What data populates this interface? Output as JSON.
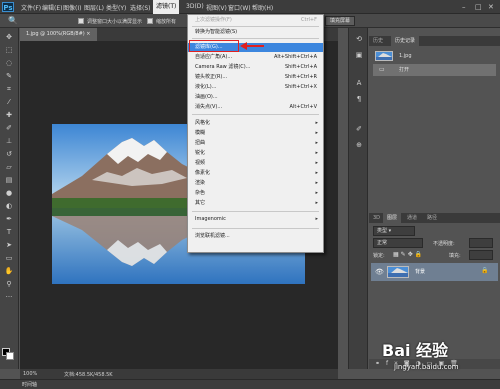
{
  "app": {
    "logo": "Ps"
  },
  "menubar": {
    "items": [
      "文件(F)",
      "编辑(E)",
      "图像(I)",
      "图层(L)",
      "类型(Y)",
      "选择(S)",
      "滤镜(T)",
      "3D(D)",
      "视图(V)",
      "窗口(W)",
      "帮助(H)"
    ],
    "active": "滤镜(T)"
  },
  "optbar": {
    "opt1": "调整窗口大小以满屏显示",
    "opt2": "缩放所有",
    "btn_fill": "填充屏幕"
  },
  "document": {
    "tab_label": "1.jpg @ 100%(RGB/8#)"
  },
  "status": {
    "zoom": "100%",
    "doc_info": "文档:458.5K/458.5K",
    "timeline": "时间轴"
  },
  "filter_menu": {
    "items": [
      {
        "label": "上次滤镜操作(F)",
        "shortcut": "Ctrl+F",
        "state": "disabled"
      },
      {
        "label": "转换为智能滤镜(S)",
        "shortcut": "",
        "state": "normal"
      },
      {
        "label": "滤镜库(G)...",
        "shortcut": "",
        "state": "highlighted"
      },
      {
        "label": "自适应广角(A)...",
        "shortcut": "Alt+Shift+Ctrl+A",
        "state": "normal"
      },
      {
        "label": "Camera Raw 滤镜(C)...",
        "shortcut": "Shift+Ctrl+A",
        "state": "normal"
      },
      {
        "label": "镜头校正(R)...",
        "shortcut": "Shift+Ctrl+R",
        "state": "normal"
      },
      {
        "label": "液化(L)...",
        "shortcut": "Shift+Ctrl+X",
        "state": "normal"
      },
      {
        "label": "油画(O)...",
        "shortcut": "",
        "state": "normal"
      },
      {
        "label": "消失点(V)...",
        "shortcut": "Alt+Ctrl+V",
        "state": "normal"
      },
      {
        "label": "风格化",
        "shortcut": "",
        "state": "submenu"
      },
      {
        "label": "模糊",
        "shortcut": "",
        "state": "submenu"
      },
      {
        "label": "扭曲",
        "shortcut": "",
        "state": "submenu"
      },
      {
        "label": "锐化",
        "shortcut": "",
        "state": "submenu"
      },
      {
        "label": "视频",
        "shortcut": "",
        "state": "submenu"
      },
      {
        "label": "像素化",
        "shortcut": "",
        "state": "submenu"
      },
      {
        "label": "渲染",
        "shortcut": "",
        "state": "submenu"
      },
      {
        "label": "杂色",
        "shortcut": "",
        "state": "submenu"
      },
      {
        "label": "其它",
        "shortcut": "",
        "state": "submenu"
      },
      {
        "label": "Imagenomic",
        "shortcut": "",
        "state": "submenu"
      },
      {
        "label": "浏览联机滤镜...",
        "shortcut": "",
        "state": "normal"
      }
    ],
    "submenu_glyph": "▸"
  },
  "history_panel": {
    "tabs": [
      "历史",
      "历史记录"
    ],
    "rows": [
      "1.jpg",
      "打开"
    ]
  },
  "layers_panel": {
    "tabs": [
      "3D",
      "图层",
      "通道",
      "路径"
    ],
    "kind_label": "类型",
    "blend_mode": "正常",
    "opacity_label": "不透明度:",
    "lock_label": "锁定:",
    "fill_label": "填充:",
    "layer_name": "背景"
  },
  "watermark": {
    "logo_text": "Bai 经验",
    "url": "jingyan.baidu.com"
  },
  "colors": {
    "highlight": "#3c86de",
    "annotation": "#e02020"
  }
}
